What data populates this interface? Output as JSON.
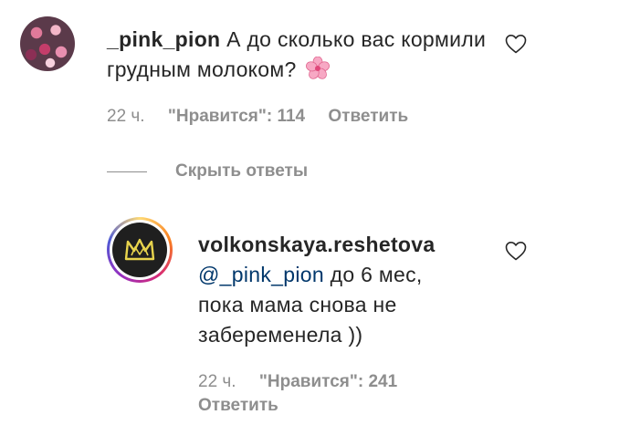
{
  "comment1": {
    "username": "_pink_pion",
    "text": "А до сколько вас кормили грудным молоком?",
    "emoji_icon": "cherry-blossom-icon",
    "time": "22 ч.",
    "likes": "\"Нравится\": 114",
    "reply_label": "Ответить"
  },
  "hide_replies": {
    "label": "Скрыть ответы"
  },
  "reply1": {
    "username": "volkonskaya.reshetova",
    "mention": "@_pink_pion",
    "text": "до 6 мес, пока мама снова не забеременела ))",
    "time": "22 ч.",
    "likes": "\"Нравится\": 241",
    "reply_label": "Ответить"
  },
  "colors": {
    "text": "#262626",
    "muted": "#8e8e8e",
    "mention": "#00376b"
  }
}
